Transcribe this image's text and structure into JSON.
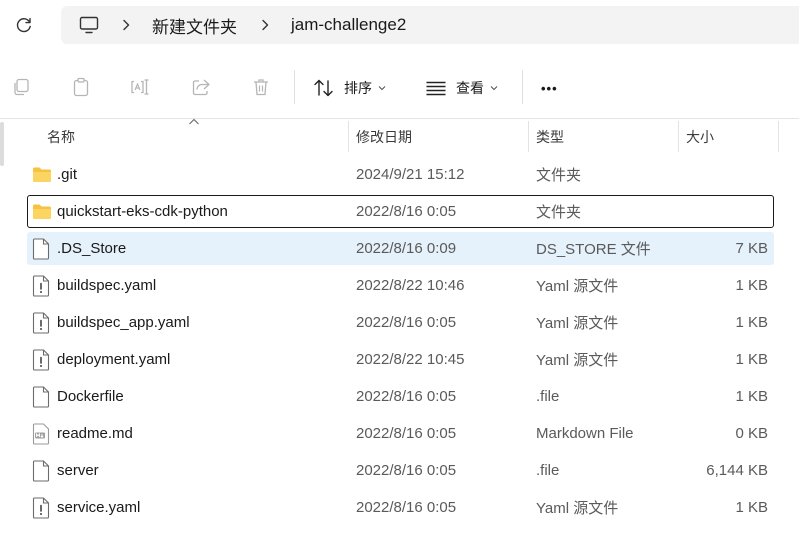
{
  "address_bar": {
    "refresh_icon": "refresh-icon",
    "computer_icon": "computer-icon",
    "breadcrumbs": [
      "新建文件夹",
      "jam-challenge2"
    ]
  },
  "toolbar": {
    "actions": [
      "copy-icon",
      "paste-icon",
      "rename-icon",
      "share-icon",
      "delete-icon"
    ],
    "sort_label": "排序",
    "view_label": "查看",
    "more_label": "•••"
  },
  "columns": {
    "name": "名称",
    "date": "修改日期",
    "type": "类型",
    "size": "大小"
  },
  "files": [
    {
      "name": ".git",
      "date": "2024/9/21 15:12",
      "type": "文件夹",
      "size": "",
      "icon": "folder-icon",
      "state": ""
    },
    {
      "name": "quickstart-eks-cdk-python",
      "date": "2022/8/16 0:05",
      "type": "文件夹",
      "size": "",
      "icon": "folder-icon",
      "state": "focused"
    },
    {
      "name": ".DS_Store",
      "date": "2022/8/16 0:09",
      "type": "DS_STORE 文件",
      "size": "7 KB",
      "icon": "file-icon",
      "state": "selected"
    },
    {
      "name": "buildspec.yaml",
      "date": "2022/8/22 10:46",
      "type": "Yaml 源文件",
      "size": "1 KB",
      "icon": "yaml-file-icon",
      "state": ""
    },
    {
      "name": "buildspec_app.yaml",
      "date": "2022/8/16 0:05",
      "type": "Yaml 源文件",
      "size": "1 KB",
      "icon": "yaml-file-icon",
      "state": ""
    },
    {
      "name": "deployment.yaml",
      "date": "2022/8/22 10:45",
      "type": "Yaml 源文件",
      "size": "1 KB",
      "icon": "yaml-file-icon",
      "state": ""
    },
    {
      "name": "Dockerfile",
      "date": "2022/8/16 0:05",
      "type": ".file",
      "size": "1 KB",
      "icon": "file-icon",
      "state": ""
    },
    {
      "name": "readme.md",
      "date": "2022/8/16 0:05",
      "type": "Markdown File",
      "size": "0 KB",
      "icon": "markdown-file-icon",
      "state": ""
    },
    {
      "name": "server",
      "date": "2022/8/16 0:05",
      "type": ".file",
      "size": "6,144 KB",
      "icon": "file-icon",
      "state": ""
    },
    {
      "name": "service.yaml",
      "date": "2022/8/16 0:05",
      "type": "Yaml 源文件",
      "size": "1 KB",
      "icon": "yaml-file-icon",
      "state": ""
    }
  ]
}
